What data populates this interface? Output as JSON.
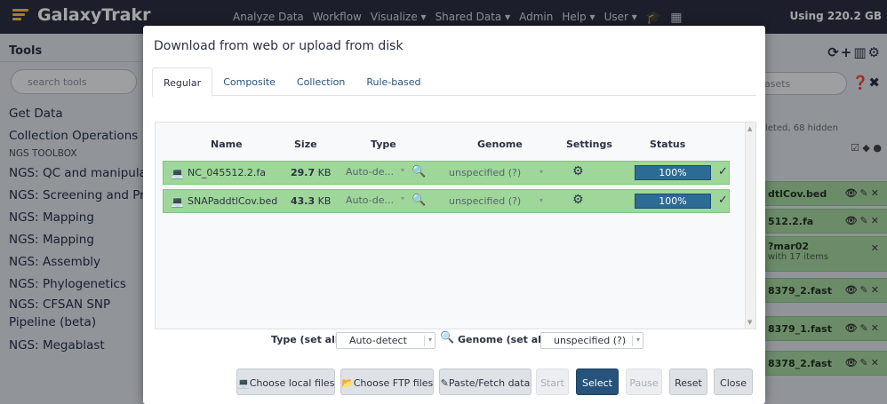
{
  "app": {
    "brand": "GalaxyTrakr",
    "nav": [
      "Analyze Data",
      "Workflow",
      "Visualize ▾",
      "Shared Data ▾",
      "Admin",
      "Help ▾",
      "User ▾"
    ],
    "usage": "Using 220.2 GB"
  },
  "tool_panel": {
    "title": "Tools",
    "search_placeholder": "search tools",
    "items": [
      {
        "label": "Get Data",
        "style": "normal"
      },
      {
        "label": "Collection Operations",
        "style": "normal"
      },
      {
        "label": "NGS TOOLBOX",
        "style": "small"
      },
      {
        "label": "NGS: QC and manipulation",
        "style": "normal"
      },
      {
        "label": "NGS: Screening and Profiling",
        "style": "normal"
      },
      {
        "label": "NGS: Mapping",
        "style": "normal"
      },
      {
        "label": "NGS: Mapping",
        "style": "normal"
      },
      {
        "label": "NGS: Assembly",
        "style": "normal"
      },
      {
        "label": "NGS: Phylogenetics",
        "style": "normal"
      },
      {
        "label": "NGS: CFSAN SNP Pipeline (beta)",
        "style": "wrap"
      },
      {
        "label": "NGS: Megablast",
        "style": "normal"
      }
    ]
  },
  "history_panel": {
    "search_placeholder": "asets",
    "info": "leted, 68 hidden",
    "datasets": [
      {
        "name": "dtlCov.bed",
        "sub": ""
      },
      {
        "name": "512.2.fa",
        "sub": ""
      },
      {
        "name": "?mar02",
        "sub": "with 17 items"
      },
      {
        "name": "8379_2.fast",
        "sub": ""
      },
      {
        "name": "8379_1.fast",
        "sub": ""
      },
      {
        "name": "8378_2.fast",
        "sub": ""
      }
    ]
  },
  "modal": {
    "title": "Download from web or upload from disk",
    "tabs": [
      {
        "label": "Regular",
        "active": true
      },
      {
        "label": "Composite",
        "active": false
      },
      {
        "label": "Collection",
        "active": false
      },
      {
        "label": "Rule-based",
        "active": false
      }
    ],
    "columns": {
      "name": "Name",
      "size": "Size",
      "type": "Type",
      "genome": "Genome",
      "settings": "Settings",
      "status": "Status"
    },
    "files": [
      {
        "name": "NC_045512.2.fa",
        "size_value": "29.7",
        "size_unit": "KB",
        "type": "Auto-de...",
        "genome": "unspecified (?)",
        "progress": "100%"
      },
      {
        "name": "SNAPaddtlCov.bed",
        "size_value": "43.3",
        "size_unit": "KB",
        "type": "Auto-de...",
        "genome": "unspecified (?)",
        "progress": "100%"
      }
    ],
    "set_all": {
      "type_label": "Type (set all):",
      "type_value": "Auto-detect",
      "genome_label": "Genome (set all):",
      "genome_value": "unspecified (?)"
    },
    "buttons": {
      "choose_local": "Choose local files",
      "choose_ftp": "Choose FTP files",
      "paste_fetch": "Paste/Fetch data",
      "start": "Start",
      "select": "Select",
      "pause": "Pause",
      "reset": "Reset",
      "close": "Close"
    }
  },
  "colors": {
    "masthead": "#2c3143",
    "row_success": "#9ed799",
    "progress": "#2c6b94",
    "primary_button": "#25537b",
    "brand_accent": "#f7c441"
  }
}
